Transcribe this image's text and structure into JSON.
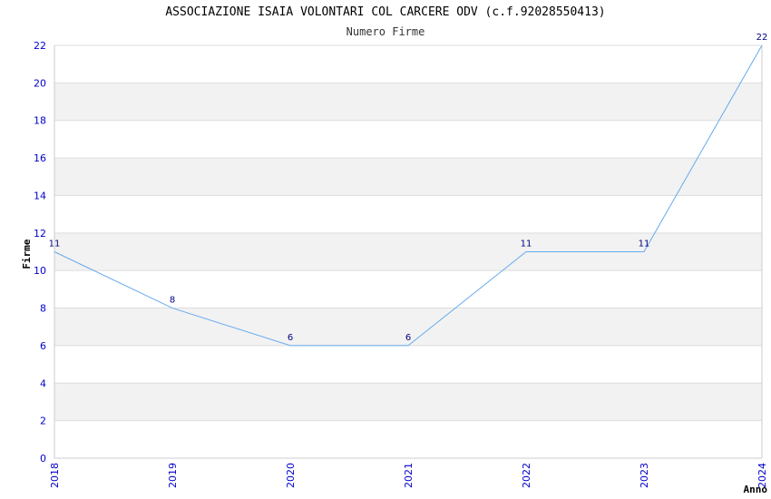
{
  "chart_data": {
    "type": "line",
    "title": "ASSOCIAZIONE ISAIA VOLONTARI COL CARCERE ODV (c.f.92028550413)",
    "subtitle": "Numero Firme",
    "xlabel": "Anno",
    "ylabel": "Firme",
    "categories": [
      "2018",
      "2019",
      "2020",
      "2021",
      "2022",
      "2023",
      "2024"
    ],
    "series": [
      {
        "values": [
          11,
          8,
          6,
          6,
          11,
          11,
          22
        ]
      }
    ],
    "ylim": [
      0,
      22
    ],
    "yticks": [
      0,
      2,
      4,
      6,
      8,
      10,
      12,
      14,
      16,
      18,
      20,
      22
    ],
    "grid": true,
    "line_color": "#66aaee",
    "band_color": "#f2f2f2",
    "tick_color": "#0000cc",
    "label_color": "#000080"
  }
}
